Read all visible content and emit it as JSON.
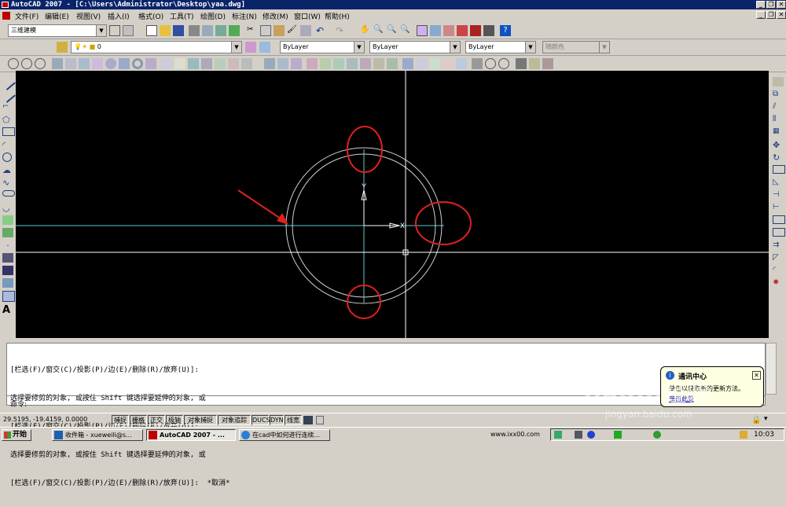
{
  "window": {
    "title": "AutoCAD 2007 - [C:\\Users\\Administrator\\Desktop\\yaa.dwg]"
  },
  "menu": [
    "文件(F)",
    "编辑(E)",
    "视图(V)",
    "插入(I)",
    "格式(O)",
    "工具(T)",
    "绘图(D)",
    "标注(N)",
    "修改(M)",
    "窗口(W)",
    "帮助(H)"
  ],
  "toolbar": {
    "workspace": "三维建模",
    "layer": "0",
    "color": "ByLayer",
    "linetype": "ByLayer",
    "lineweight": "ByLayer",
    "plotstyle": "随颜色"
  },
  "drawing": {
    "y_axis_label": "Y",
    "x_axis_label": "X"
  },
  "command": {
    "history": [
      "[栏选(F)/窗交(C)/投影(P)/边(E)/删除(R)/放弃(U)]:",
      "选择要修剪的对象, 或按住 Shift 键选择要延伸的对象, 或",
      "[栏选(F)/窗交(C)/投影(P)/边(E)/删除(R)/放弃(U)]:",
      "选择要修剪的对象, 或按住 Shift 键选择要延伸的对象, 或",
      "[栏选(F)/窗交(C)/投影(P)/边(E)/删除(R)/放弃(U)]:  *取消*"
    ],
    "prompt": "命令:"
  },
  "status": {
    "coords": "29.5195, -19.4159, 0.0000",
    "toggles": [
      "捕捉",
      "栅格",
      "正交",
      "极轴",
      "对象捕捉",
      "对象追踪",
      "DUCS",
      "DYN",
      "线宽"
    ]
  },
  "balloon": {
    "title": "通讯中心",
    "text": "单击以获取新的更新方法。",
    "link": "单击此处"
  },
  "taskbar": {
    "start": "开始",
    "tasks": [
      "收件箱 - xueweili@s...",
      "AutoCAD 2007 - ...",
      "在cad中如何进行连续..."
    ],
    "url": "www.ixx00.com",
    "clock": "10:03"
  },
  "watermark": {
    "text": "Baidu经验",
    "url": "jingyan.baidu.com"
  }
}
